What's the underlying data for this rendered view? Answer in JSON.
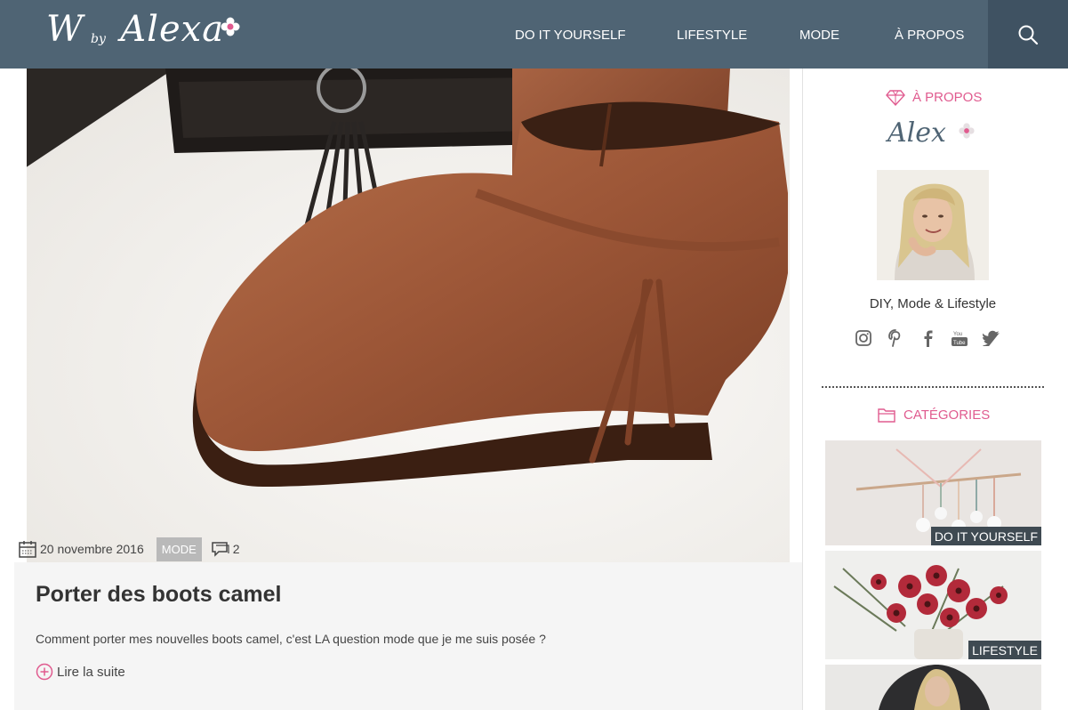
{
  "header": {
    "logo_text": "W",
    "logo_by": "by",
    "logo_name": "Alexa",
    "nav": [
      {
        "label": "DO IT YOURSELF"
      },
      {
        "label": "LIFESTYLE"
      },
      {
        "label": "MODE"
      },
      {
        "label": "À PROPOS"
      }
    ],
    "search_icon": "search-icon"
  },
  "post": {
    "date": "20 novembre 2016",
    "category": "MODE",
    "comments": "2",
    "title": "Porter des boots camel",
    "excerpt": "Comment porter mes nouvelles boots camel, c'est LA question mode que je me suis posée ?",
    "read_more": "Lire la suite"
  },
  "sidebar": {
    "about_title": "À PROPOS",
    "signature": "Alex",
    "tagline": "DIY, Mode & Lifestyle",
    "socials": [
      "instagram-icon",
      "pinterest-icon",
      "facebook-icon",
      "youtube-icon",
      "twitter-icon"
    ],
    "categories_title": "CATÉGORIES",
    "categories": [
      {
        "label": "DO IT YOURSELF"
      },
      {
        "label": "LIFESTYLE"
      },
      {
        "label": ""
      }
    ]
  },
  "colors": {
    "header_bg": "#4f6474",
    "search_bg": "#3f5262",
    "accent_pink": "#e05b8f",
    "category_badge": "#b9b9b9",
    "card_label_bg": "#3f4a52"
  }
}
